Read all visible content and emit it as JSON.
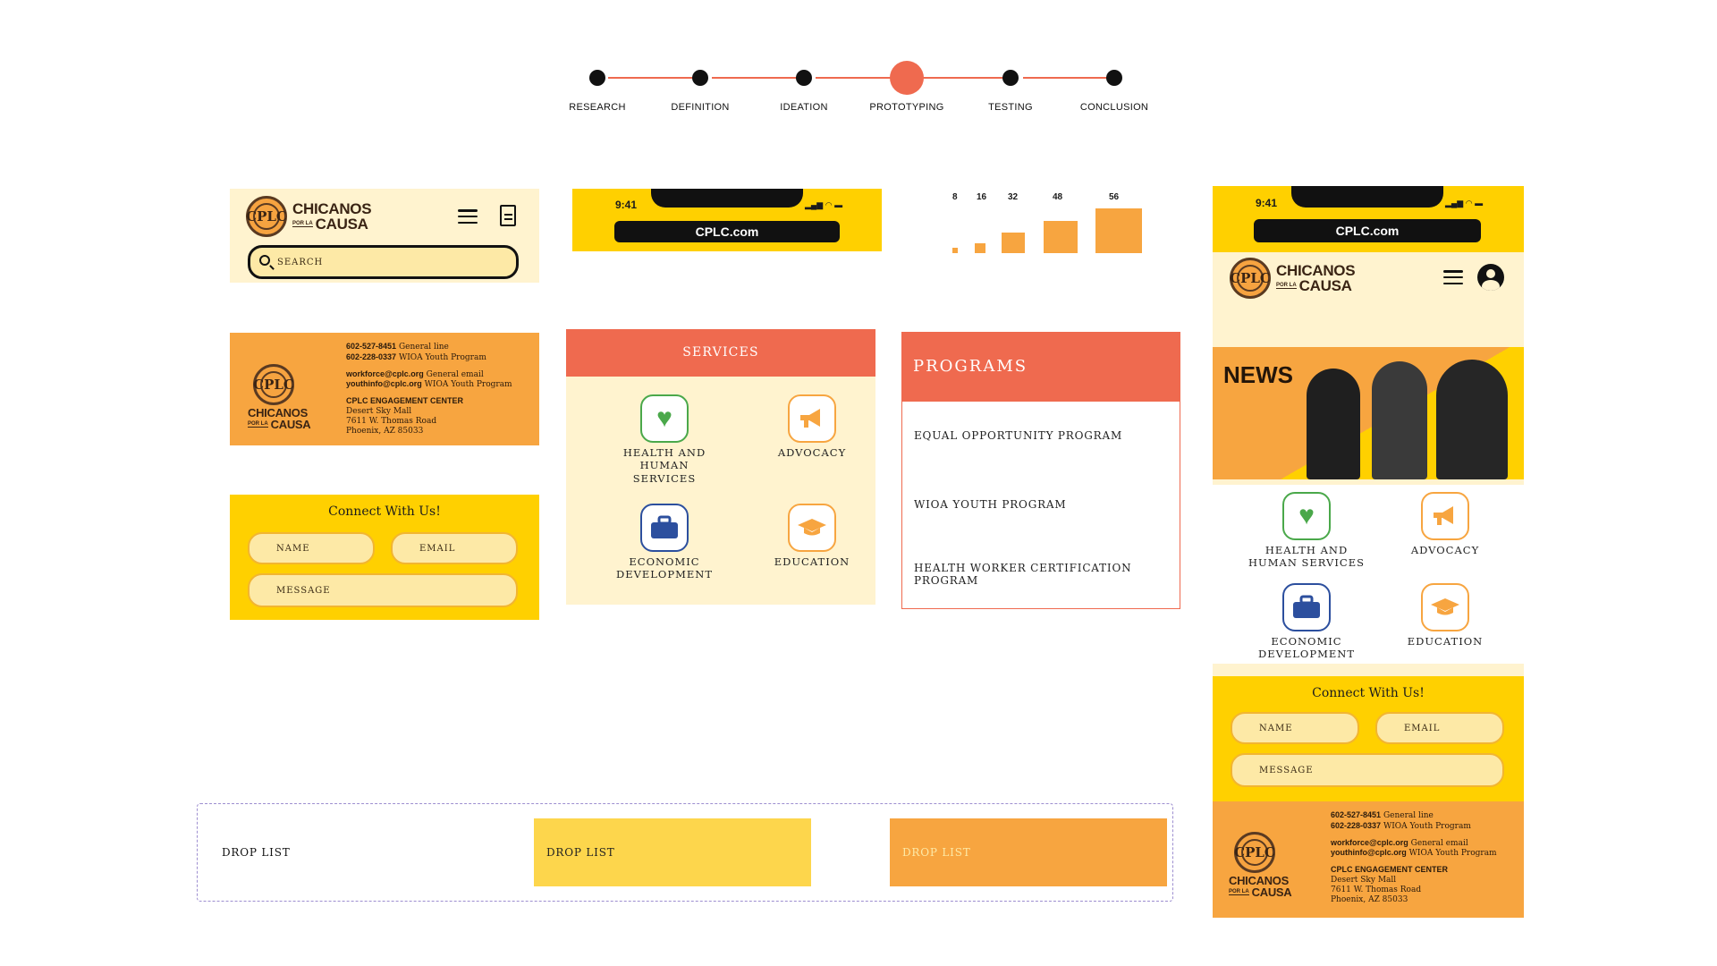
{
  "stepper": {
    "steps": [
      "RESEARCH",
      "DEFINITION",
      "IDEATION",
      "PROTOTYPING",
      "TESTING",
      "CONCLUSION"
    ],
    "active_index": 3
  },
  "logo": {
    "top": "CHICANOS",
    "por": "POR LA",
    "bottom": "CAUSA",
    "seal": "CPLC"
  },
  "header": {
    "search_placeholder": "SEARCH",
    "menu_icon": "hamburger-icon",
    "doc_icon": "document-icon",
    "user_icon": "user-icon"
  },
  "phone": {
    "time": "9:41",
    "url": "CPLC.com"
  },
  "spacing_scale": {
    "values": [
      "8",
      "16",
      "32",
      "48",
      "56"
    ]
  },
  "contact": {
    "line1": "602-527-8451",
    "line1_label": "General line",
    "line2": "602-228-0337",
    "line2_label": "WIOA Youth Program",
    "email1": "workforce@cplc.org",
    "email1_label": "General email",
    "email2": "youthinfo@cplc.org",
    "email2_label": "WIOA Youth Program",
    "center": "CPLC ENGAGEMENT CENTER",
    "addr1": "Desert Sky Mall",
    "addr2": "7611 W. Thomas Road",
    "addr3": "Phoenix, AZ 85033"
  },
  "connect": {
    "title": "Connect With Us!",
    "name": "NAME",
    "email": "EMAIL",
    "message": "MESSAGE"
  },
  "services": {
    "title": "SERVICES",
    "items": [
      {
        "line1": "HEALTH AND",
        "line2": "HUMAN SERVICES",
        "icon": "heart-plus-icon"
      },
      {
        "line1": "ADVOCACY",
        "line2": "",
        "icon": "megaphone-icon"
      },
      {
        "line1": "ECONOMIC",
        "line2": "DEVELOPMENT",
        "icon": "briefcase-icon"
      },
      {
        "line1": "EDUCATION",
        "line2": "",
        "icon": "graduation-cap-icon"
      }
    ]
  },
  "programs": {
    "title": "PROGRAMS",
    "items": [
      "EQUAL OPPORTUNITY PROGRAM",
      "WIOA YOUTH PROGRAM",
      "HEALTH WORKER CERTIFICATION",
      "PROGRAM"
    ]
  },
  "news": {
    "title": "NEWS"
  },
  "droplist": {
    "items": [
      "DROP LIST",
      "DROP LIST",
      "DROP LIST"
    ]
  },
  "colors": {
    "accent": "#ef6a4f",
    "yellow": "#ffd000",
    "orange": "#f7a540",
    "cream": "#fff3cf"
  }
}
